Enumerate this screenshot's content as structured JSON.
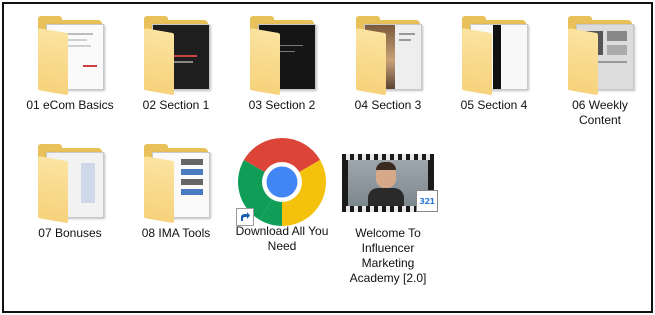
{
  "items": [
    {
      "label": "01 eCom Basics",
      "kind": "folder",
      "icon": "folder-icon"
    },
    {
      "label": "02 Section 1",
      "kind": "folder",
      "icon": "folder-icon"
    },
    {
      "label": "03 Section 2",
      "kind": "folder",
      "icon": "folder-icon"
    },
    {
      "label": "04 Section 3",
      "kind": "folder",
      "icon": "folder-icon"
    },
    {
      "label": "05 Section 4",
      "kind": "folder",
      "icon": "folder-icon"
    },
    {
      "label": "06 Weekly Content",
      "kind": "folder",
      "icon": "folder-icon"
    },
    {
      "label": "07 Bonuses",
      "kind": "folder",
      "icon": "folder-icon"
    },
    {
      "label": "08 IMA Tools",
      "kind": "folder",
      "icon": "folder-icon"
    },
    {
      "label": "Download All You Need",
      "kind": "shortcut",
      "icon": "chrome-icon"
    },
    {
      "label": "Welcome To Influencer Marketing Academy [2.0]",
      "kind": "video",
      "icon": "video-thumbnail-icon"
    }
  ],
  "colors": {
    "folder": "#e8c15a",
    "folder_front": "#f6d27b",
    "chrome_red": "#db4437",
    "chrome_yellow": "#f4c20d",
    "chrome_green": "#0f9d58",
    "chrome_blue": "#4285f4"
  },
  "video_badge": "321"
}
